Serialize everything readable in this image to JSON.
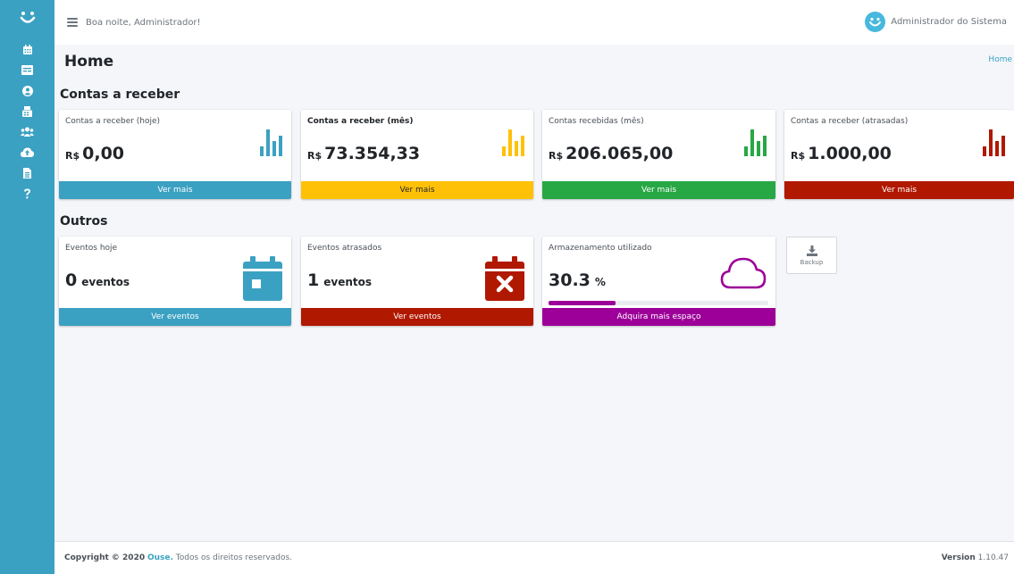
{
  "topbar": {
    "greeting": "Boa noite, Administrador!",
    "user_name": "Administrador do Sistema"
  },
  "page": {
    "title": "Home",
    "breadcrumb": "Home"
  },
  "sections": {
    "receivables": "Contas a receber",
    "others": "Outros"
  },
  "receivables": [
    {
      "label": "Contas a receber (hoje)",
      "currency": "R$",
      "value": "0,00",
      "action": "Ver mais",
      "color": "#3ba1c2"
    },
    {
      "label": "Contas a receber (mês)",
      "currency": "R$",
      "value": "73.354,33",
      "action": "Ver mais",
      "color": "#ffc107"
    },
    {
      "label": "Contas recebidas (mês)",
      "currency": "R$",
      "value": "206.065,00",
      "action": "Ver mais",
      "color": "#28a745"
    },
    {
      "label": "Contas a receber (atrasadas)",
      "currency": "R$",
      "value": "1.000,00",
      "action": "Ver mais",
      "color": "#b01800"
    }
  ],
  "others": {
    "events_today": {
      "label": "Eventos hoje",
      "value": "0",
      "unit": "eventos",
      "action": "Ver eventos",
      "color": "#3ba1c2"
    },
    "events_late": {
      "label": "Eventos atrasados",
      "value": "1",
      "unit": "eventos",
      "action": "Ver eventos",
      "color": "#b01800"
    },
    "storage": {
      "label": "Armazenamento utilizado",
      "value": "30.3",
      "unit": "%",
      "percent": 30.3,
      "action": "Adquira mais espaço",
      "color": "#9c0098"
    }
  },
  "backup": {
    "label": "Backup"
  },
  "footer": {
    "copyright_prefix": "Copyright © 2020",
    "brand": "Ouse.",
    "rights": "Todos os direitos reservados.",
    "version_label": "Version",
    "version": "1.10.47"
  },
  "icons": {
    "sidebar": [
      "calendar-icon",
      "id-card-icon",
      "user-circle-icon",
      "fax-icon",
      "users-icon",
      "cloud-upload-icon",
      "file-icon",
      "question-icon"
    ]
  }
}
